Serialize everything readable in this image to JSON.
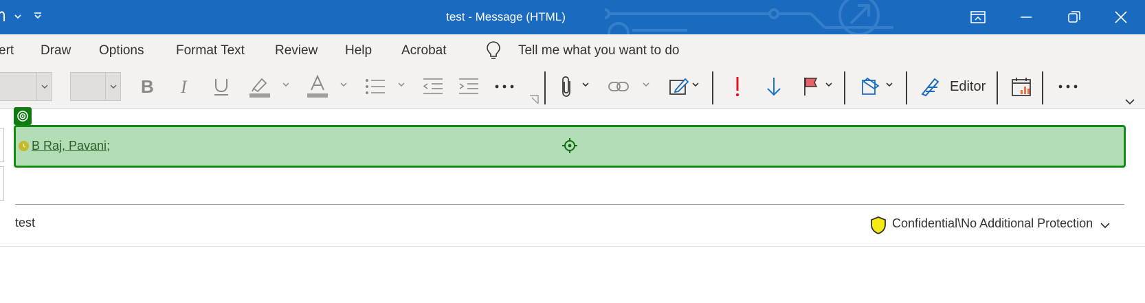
{
  "window": {
    "title": "test  -  Message (HTML)"
  },
  "menu_tabs": [
    "ert",
    "Draw",
    "Options",
    "Format Text",
    "Review",
    "Help",
    "Acrobat"
  ],
  "tell_me": "Tell me what you want to do",
  "ribbon": {
    "editor_label": "Editor"
  },
  "compose": {
    "to_recipient_name": "B Raj, Pavani",
    "to_separator": ";",
    "subject": "test",
    "sensitivity_label": "Confidential\\No Additional Protection"
  },
  "colors": {
    "titlebar": "#1a6bbf",
    "ribbon_bg": "#f3f2f1",
    "focus_highlight": "#b3ddb5",
    "focus_border": "#138a13",
    "importance_high": "#e81123",
    "importance_low": "#1a73d0",
    "sensitivity_shield": "#f5ea14"
  },
  "icons": {
    "quick_access": [
      "touch-mode-icon",
      "chevron-down-icon",
      "customize-qat-icon"
    ],
    "window_controls": [
      "ribbon-display-icon",
      "minimize-icon",
      "restore-icon",
      "close-icon"
    ],
    "ribbon": [
      "bold-icon",
      "italic-icon",
      "underline-icon",
      "highlight-icon",
      "font-color-icon",
      "bullets-icon",
      "decrease-indent-icon",
      "increase-indent-icon",
      "more-icon",
      "attach-file-icon",
      "link-icon",
      "signature-icon",
      "high-importance-icon",
      "low-importance-icon",
      "follow-up-flag-icon",
      "sensitivity-icon",
      "editor-icon",
      "viva-insights-icon",
      "more-commands-icon",
      "collapse-ribbon-icon"
    ]
  }
}
